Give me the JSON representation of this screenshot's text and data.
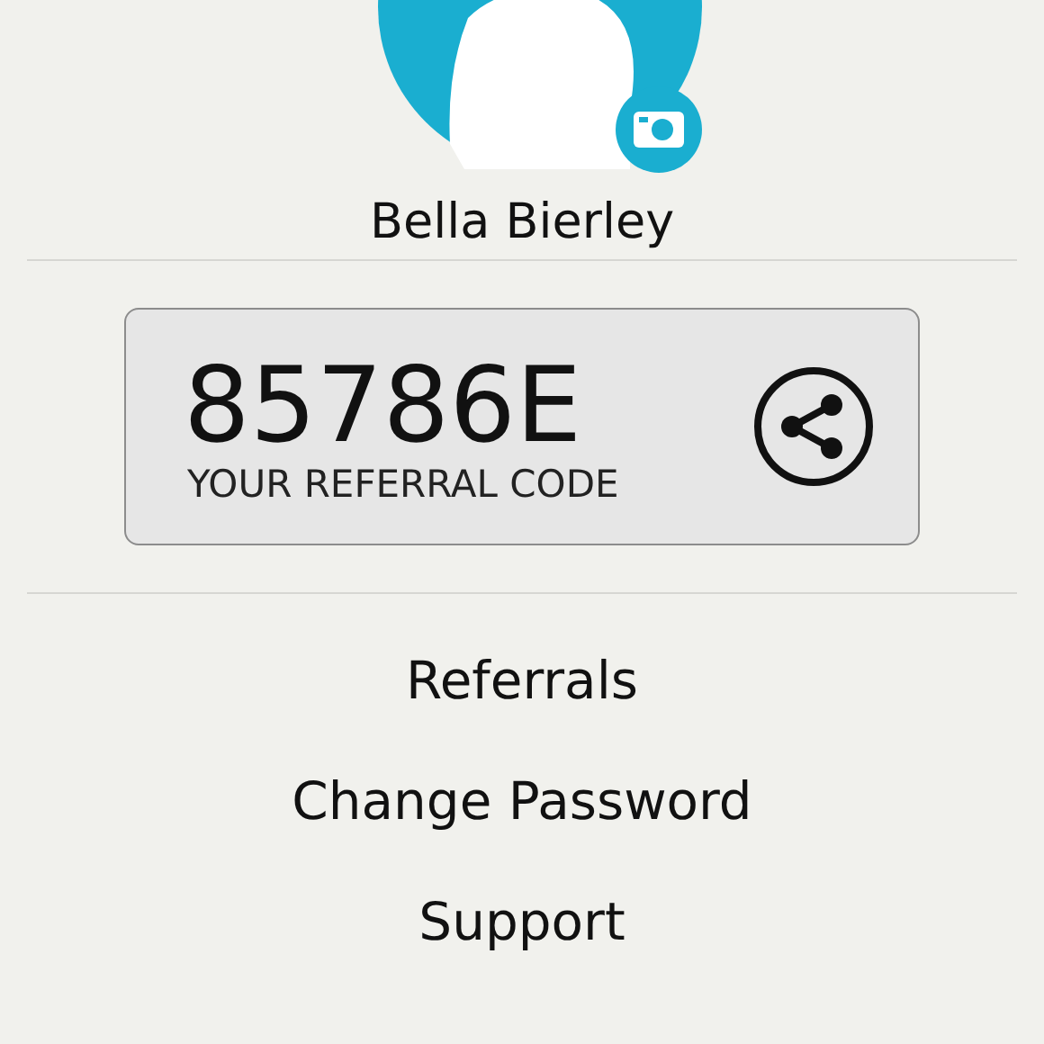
{
  "profile": {
    "name": "Bella Bierley"
  },
  "referral": {
    "code": "85786E",
    "label": "YOUR REFERRAL CODE"
  },
  "menu": [
    {
      "label": "Referrals"
    },
    {
      "label": "Change Password"
    },
    {
      "label": "Support"
    }
  ]
}
